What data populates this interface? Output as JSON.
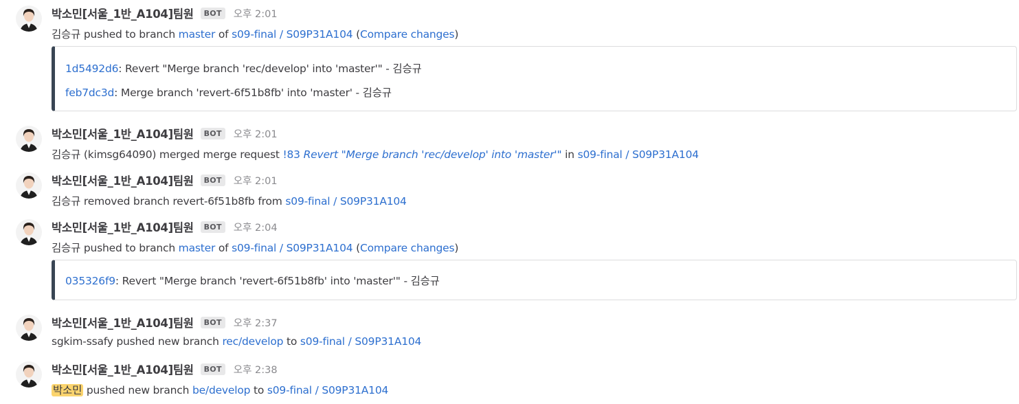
{
  "bot_badge": "BOT",
  "posts": [
    {
      "username": "박소민[서울_1반_A104]팀원",
      "time": "오후 2:01",
      "pre": "김승규 pushed to branch ",
      "branch": "master",
      "of": " of ",
      "repo": "s09-final / S09P31A104",
      "paren_open": " (",
      "compare": "Compare changes",
      "paren_close": ")",
      "commits": [
        {
          "hash": "1d5492d6",
          "msg": ": Revert \"Merge branch 'rec/develop' into 'master'\" - 김승규"
        },
        {
          "hash": "feb7dc3d",
          "msg": ": Merge branch 'revert-6f51b8fb' into 'master' - 김승규"
        }
      ]
    },
    {
      "username": "박소민[서울_1반_A104]팀원",
      "time": "오후 2:01",
      "pre": "김승규 (kimsg64090) merged merge request ",
      "mr_num": "!83",
      "mr_title": " Revert \"Merge branch 'rec/develop' into 'master'\"",
      "in": " in ",
      "repo": "s09-final / S09P31A104"
    },
    {
      "username": "박소민[서울_1반_A104]팀원",
      "time": "오후 2:01",
      "pre": "김승규 removed branch revert-6f51b8fb from ",
      "repo": "s09-final / S09P31A104"
    },
    {
      "username": "박소민[서울_1반_A104]팀원",
      "time": "오후 2:04",
      "pre": "김승규 pushed to branch ",
      "branch": "master",
      "of": " of ",
      "repo": "s09-final / S09P31A104",
      "paren_open": " (",
      "compare": "Compare changes",
      "paren_close": ")",
      "commits": [
        {
          "hash": "035326f9",
          "msg": ": Revert \"Merge branch 'revert-6f51b8fb' into 'master'\" - 김승규"
        }
      ]
    },
    {
      "username": "박소민[서울_1반_A104]팀원",
      "time": "오후 2:37",
      "pre": "sgkim-ssafy pushed new branch ",
      "branch": "rec/develop",
      "to": " to ",
      "repo": "s09-final / S09P31A104"
    },
    {
      "username": "박소민[서울_1반_A104]팀원",
      "time": "오후 2:38",
      "mention": "박소민",
      "pre": " pushed new branch ",
      "branch": "be/develop",
      "to": " to ",
      "repo": "s09-final / S09P31A104"
    }
  ]
}
